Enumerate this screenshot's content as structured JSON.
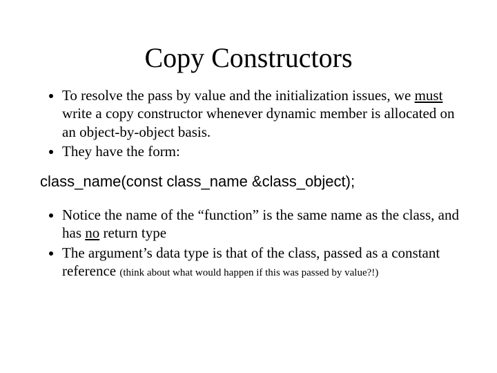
{
  "title": "Copy Constructors",
  "bullets_top": {
    "b1": {
      "before": "To resolve the pass by value and the initialization issues, we ",
      "underlined": "must",
      "after": " write a copy constructor whenever dynamic member is allocated on an object-by-object basis."
    },
    "b2": "They have the form:"
  },
  "code": "class_name(const class_name &class_object);",
  "bullets_bottom": {
    "b3": {
      "before": "Notice the name of the “function” is the same name as the class, and has ",
      "underlined": "no",
      "after": " return type"
    },
    "b4": {
      "main": "The argument’s data type is that of the class, passed as a constant reference ",
      "note": "(think about what would happen if this was passed by value?!)"
    }
  }
}
